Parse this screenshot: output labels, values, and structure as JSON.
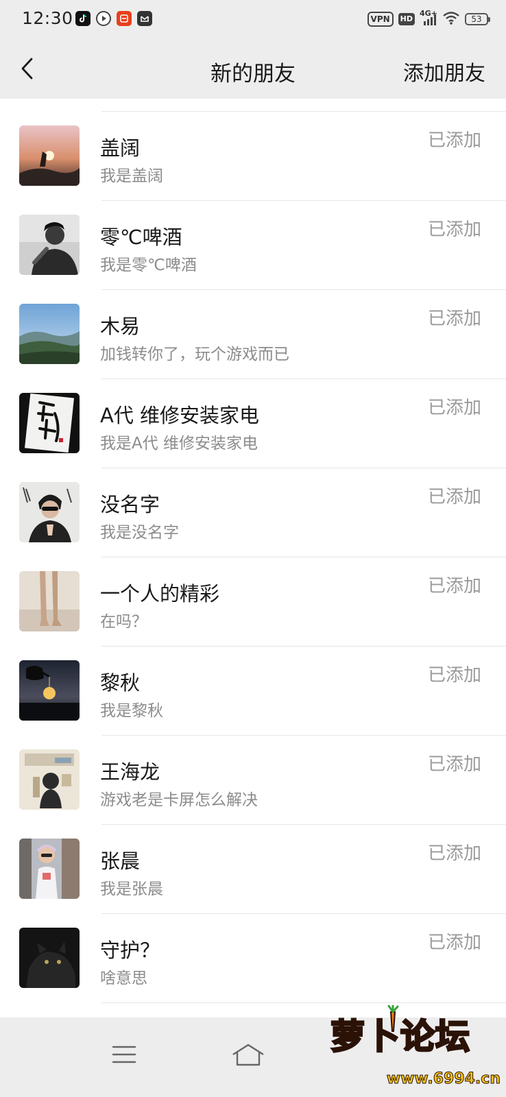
{
  "status_bar": {
    "time": "12:30",
    "vpn": "VPN",
    "hd": "HD",
    "network": "4G+",
    "battery": "53"
  },
  "nav": {
    "title": "新的朋友",
    "action": "添加朋友"
  },
  "friends": [
    {
      "name": "盖阔",
      "message": "我是盖阔",
      "status": "已添加"
    },
    {
      "name": "零℃啤酒",
      "message": "我是零℃啤酒",
      "status": "已添加"
    },
    {
      "name": "木易",
      "message": "加钱转你了，玩个游戏而已",
      "status": "已添加"
    },
    {
      "name": "A代 维修安装家电",
      "message": "我是A代 维修安装家电",
      "status": "已添加"
    },
    {
      "name": "没名字",
      "message": "我是没名字",
      "status": "已添加"
    },
    {
      "name": "一个人的精彩",
      "message": "在吗？",
      "status": "已添加"
    },
    {
      "name": "黎秋",
      "message": "我是黎秋",
      "status": "已添加"
    },
    {
      "name": "王海龙",
      "message": "游戏老是卡屏怎么解决",
      "status": "已添加"
    },
    {
      "name": "张晨",
      "message": "我是张晨",
      "status": "已添加"
    },
    {
      "name": "守护？",
      "message": "啥意思",
      "status": "已添加"
    }
  ],
  "watermark": {
    "text": "萝卜论坛",
    "url": "www.6994.cn"
  },
  "colors": {
    "header_bg": "#ededed",
    "list_bg": "#ffffff",
    "name_text": "#1a1a1a",
    "secondary_text": "#8c8c8c",
    "status_text": "#9a9a9a",
    "divider": "#e6e6e6"
  },
  "icons": {
    "back": "chevron-left-icon",
    "menu": "menu-icon",
    "home": "home-icon"
  }
}
